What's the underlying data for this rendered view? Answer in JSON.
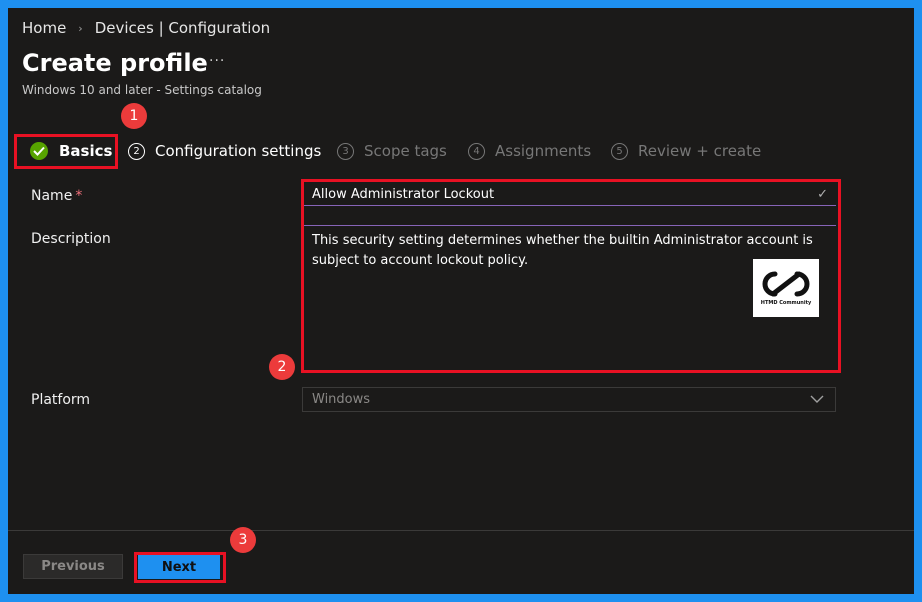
{
  "breadcrumb": {
    "home": "Home",
    "current": "Devices | Configuration"
  },
  "header": {
    "title": "Create profile",
    "more": "···",
    "subtitle": "Windows 10 and later - Settings catalog"
  },
  "steps": [
    {
      "num": "",
      "label": "Basics"
    },
    {
      "num": "2",
      "label": "Configuration settings"
    },
    {
      "num": "3",
      "label": "Scope tags"
    },
    {
      "num": "4",
      "label": "Assignments"
    },
    {
      "num": "5",
      "label": "Review + create"
    }
  ],
  "form": {
    "name_label": "Name",
    "required": "*",
    "name_value": "Allow Administrator Lockout",
    "description_label": "Description",
    "description_value": "This security setting determines whether the builtin Administrator account is subject to account lockout policy.",
    "platform_label": "Platform",
    "platform_value": "Windows"
  },
  "logo": {
    "text": "HTMD Community"
  },
  "footer": {
    "previous": "Previous",
    "next": "Next"
  },
  "annotations": [
    "1",
    "2",
    "3"
  ],
  "colors": {
    "accent": "#1e90f0",
    "highlight": "#e81123",
    "badge": "#ec3b3b",
    "success": "#57a300"
  }
}
